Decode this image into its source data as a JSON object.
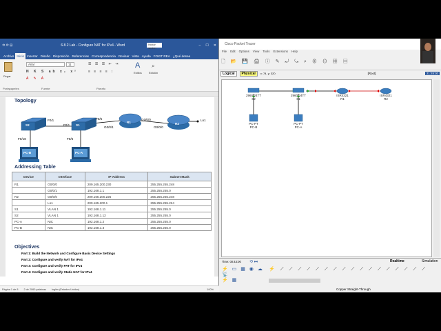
{
  "word": {
    "qat": "⟲ ⟳ ⊟",
    "doc_title": "6.8.2 Lab - Configure NAT for IPv4 - Word",
    "search": "Iniciar sesión",
    "share": "Compartir",
    "tabs": [
      "Archivo",
      "Inicio",
      "Insertar",
      "Diseño",
      "Disposición",
      "Referencias",
      "Correspondencia",
      "Revisar",
      "Vista",
      "Ayuda",
      "FOXIT REA",
      "¿Qué desea"
    ],
    "clipboard": "Portapapeles",
    "font": "Arial",
    "fontsize": "11",
    "groups": {
      "fuente": "Fuente",
      "parrafo": "Párrafo",
      "estilos": "Estilos",
      "edicion": "Edición"
    },
    "paste": "Pegar",
    "topology_title": "Topology",
    "devices": {
      "s2": "S2",
      "s1": "S1",
      "r1": "R1",
      "r2": "R2",
      "pcb": "PC-B",
      "pca": "PC-A",
      "lo1": "Lo1"
    },
    "ports": {
      "f01a": "F0/1",
      "f01b": "F0/1",
      "f05": "F0/5",
      "g000a": "G0/0/0",
      "g000b": "G0/0/0",
      "g001": "G0/0/1",
      "f018": "F0/18",
      "f06": "F0/6"
    },
    "addressing_title": "Addressing Table",
    "table_headers": [
      "Device",
      "Interface",
      "IP Address",
      "Subnet Mask"
    ],
    "table_rows": [
      [
        "R1",
        "G0/0/0",
        "209.165.200.230",
        "255.255.255.248"
      ],
      [
        "",
        "G0/0/1",
        "192.168.1.1",
        "255.255.255.0"
      ],
      [
        "R2",
        "G0/0/0",
        "209.165.200.225",
        "255.255.255.248"
      ],
      [
        "",
        "Lo1",
        "209.165.200.1",
        "255.255.255.224"
      ],
      [
        "S1",
        "VLAN 1",
        "192.168.1.11",
        "255.255.255.0"
      ],
      [
        "S2",
        "VLAN 1",
        "192.168.1.12",
        "255.255.255.0"
      ],
      [
        "PC-A",
        "NIC",
        "192.168.1.2",
        "255.255.255.0"
      ],
      [
        "PC-B",
        "NIC",
        "192.168.1.3",
        "255.255.255.0"
      ]
    ],
    "objectives_title": "Objectives",
    "objectives": [
      "Part 1: Build the Network and Configure Basic Device Settings",
      "Part 2: Configure and verify NAT for IPv4",
      "Part 3: Configure and verify PAT for IPv4",
      "Part 4: Configure and verify Static NAT for IPv4"
    ],
    "status": {
      "page": "Página 1 de 8",
      "words": "2 de 2060 palabras",
      "lang": "Inglés (Estados Unidos)",
      "zoom": "100%"
    }
  },
  "pt": {
    "title": "Cisco Packet Tracer",
    "menu": [
      "File",
      "Edit",
      "Options",
      "View",
      "Tools",
      "Extensions",
      "Help"
    ],
    "tab_logical": "Logical",
    "tab_physical": "Physical",
    "coords": "x: 74, y: 320",
    "root": "[Root]",
    "clock": "21:28:30",
    "devices": [
      {
        "model": "2960-24TT",
        "name": "S2"
      },
      {
        "model": "2960-24TT",
        "name": "S1"
      },
      {
        "model": "ISR4321",
        "name": "R1"
      },
      {
        "model": "ISR4321",
        "name": "R2"
      },
      {
        "model": "PC-PT",
        "name": "PC-B"
      },
      {
        "model": "PC-PT",
        "name": "PC-A"
      }
    ],
    "time": "Time: 00:43:00",
    "realtime": "Realtime",
    "simulation": "Simulation",
    "cable": "Copper Straight-Through"
  }
}
